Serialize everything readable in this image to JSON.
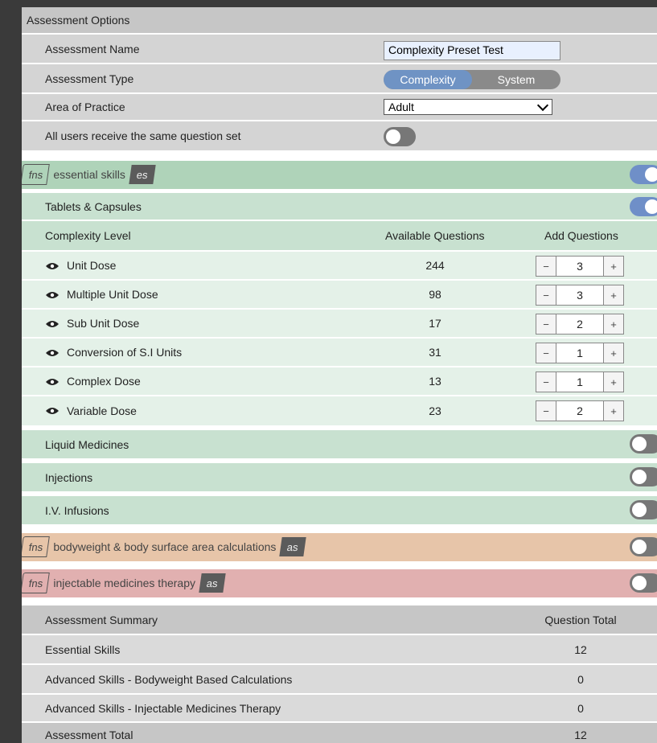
{
  "options": {
    "header": "Assessment Options",
    "name_label": "Assessment Name",
    "name_value": "Complexity Preset Test",
    "type_label": "Assessment Type",
    "type_options": [
      "Complexity",
      "System"
    ],
    "type_selected": "Complexity",
    "area_label": "Area of Practice",
    "area_value": "Adult",
    "same_set_label": "All users receive the same question set",
    "same_set_on": false
  },
  "sections": {
    "essential": {
      "fns": "fns",
      "title": "essential skills",
      "badge": "es",
      "enabled": true
    },
    "bodyweight": {
      "fns": "fns",
      "title": "bodyweight & body surface area calculations",
      "badge": "as",
      "enabled": false
    },
    "injectable": {
      "fns": "fns",
      "title": "injectable medicines therapy",
      "badge": "as",
      "enabled": false
    }
  },
  "tablets": {
    "title": "Tablets & Capsules",
    "enabled": true,
    "col_level": "Complexity Level",
    "col_available": "Available Questions",
    "col_add": "Add Questions",
    "rows": [
      {
        "label": "Unit Dose",
        "available": "244",
        "add": "3"
      },
      {
        "label": "Multiple Unit Dose",
        "available": "98",
        "add": "3"
      },
      {
        "label": "Sub Unit Dose",
        "available": "17",
        "add": "2"
      },
      {
        "label": "Conversion of S.I Units",
        "available": "31",
        "add": "1"
      },
      {
        "label": "Complex Dose",
        "available": "13",
        "add": "1"
      },
      {
        "label": "Variable Dose",
        "available": "23",
        "add": "2"
      }
    ]
  },
  "categories": [
    {
      "label": "Liquid Medicines",
      "enabled": false
    },
    {
      "label": "Injections",
      "enabled": false
    },
    {
      "label": "I.V. Infusions",
      "enabled": false
    }
  ],
  "summary": {
    "header": "Assessment Summary",
    "col_total": "Question Total",
    "rows": [
      {
        "label": "Essential Skills",
        "total": "12"
      },
      {
        "label": "Advanced Skills - Bodyweight Based Calculations",
        "total": "0"
      },
      {
        "label": "Advanced Skills - Injectable Medicines Therapy",
        "total": "0"
      },
      {
        "label": "Assessment Total",
        "total": "12"
      }
    ]
  },
  "icons": {
    "eye": "eye-icon",
    "minus": "minus-icon",
    "plus": "plus-icon"
  }
}
